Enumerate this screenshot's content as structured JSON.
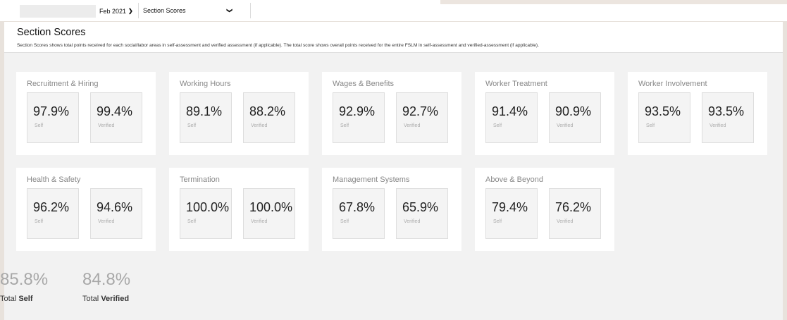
{
  "toolbar": {
    "date_value": "Feb 2021",
    "section_value": "Section Scores"
  },
  "header": {
    "title": "Section Scores",
    "description": "Section Scores shows total points received for each social/labor areas in self-assessment and verified assessment (if applicable). The total score shows overall points received for the entire FSLM in self-assessment and verified-assessment (if applicable)."
  },
  "labels": {
    "self": "Self",
    "verified": "Verified"
  },
  "sections": [
    {
      "name": "Recruitment & Hiring",
      "self": "97.9%",
      "verified": "99.4%"
    },
    {
      "name": "Working Hours",
      "self": "89.1%",
      "verified": "88.2%"
    },
    {
      "name": "Wages & Benefits",
      "self": "92.9%",
      "verified": "92.7%"
    },
    {
      "name": "Worker Treatment",
      "self": "91.4%",
      "verified": "90.9%"
    },
    {
      "name": "Worker Involvement",
      "self": "93.5%",
      "verified": "93.5%"
    },
    {
      "name": "Health & Safety",
      "self": "96.2%",
      "verified": "94.6%"
    },
    {
      "name": "Termination",
      "self": "100.0%",
      "verified": "100.0%"
    },
    {
      "name": "Management Systems",
      "self": "67.8%",
      "verified": "65.9%"
    },
    {
      "name": "Above & Beyond",
      "self": "79.4%",
      "verified": "76.2%"
    }
  ],
  "totals": {
    "self_value": "85.8%",
    "verified_value": "84.8%",
    "total_word": "Total",
    "self_word": "Self",
    "verified_word": "Verified"
  }
}
